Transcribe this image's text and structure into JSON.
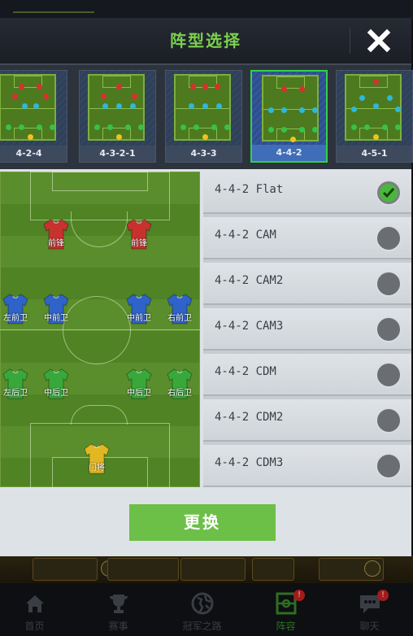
{
  "background": {
    "top_tabs": [
      "",
      "",
      "",
      ""
    ],
    "card_names": [
      "",
      "",
      "",
      "",
      ""
    ],
    "bottom_nav": [
      {
        "label": "首页",
        "icon": "home-icon"
      },
      {
        "label": "赛事",
        "icon": "trophy-icon"
      },
      {
        "label": "冠军之路",
        "icon": "globe-icon"
      },
      {
        "label": "阵容",
        "icon": "lineup-icon",
        "active": true,
        "badge": "!"
      },
      {
        "label": "聊天",
        "icon": "chat-icon",
        "badge": "!"
      }
    ]
  },
  "modal": {
    "title": "阵型选择",
    "close_icon": "close-icon"
  },
  "formations": [
    {
      "label": "4-2-4",
      "selected": false
    },
    {
      "label": "4-3-2-1",
      "selected": false
    },
    {
      "label": "4-3-3",
      "selected": false
    },
    {
      "label": "4-4-2",
      "selected": true
    },
    {
      "label": "4-5-1",
      "selected": false
    }
  ],
  "pitch": {
    "players": [
      {
        "name": "前锋",
        "role": "forward"
      },
      {
        "name": "前锋",
        "role": "forward"
      },
      {
        "name": "左前卫",
        "role": "midfielder"
      },
      {
        "name": "中前卫",
        "role": "midfielder"
      },
      {
        "name": "中前卫",
        "role": "midfielder"
      },
      {
        "name": "右前卫",
        "role": "midfielder"
      },
      {
        "name": "左后卫",
        "role": "defender"
      },
      {
        "name": "中后卫",
        "role": "defender"
      },
      {
        "name": "中后卫",
        "role": "defender"
      },
      {
        "name": "右后卫",
        "role": "defender"
      },
      {
        "name": "门将",
        "role": "goalkeeper"
      }
    ]
  },
  "variants": [
    {
      "label": "4-4-2 Flat",
      "checked": true
    },
    {
      "label": "4-4-2 CAM",
      "checked": false
    },
    {
      "label": "4-4-2 CAM2",
      "checked": false
    },
    {
      "label": "4-4-2 CAM3",
      "checked": false
    },
    {
      "label": "4-4-2 CDM",
      "checked": false
    },
    {
      "label": "4-4-2 CDM2",
      "checked": false
    },
    {
      "label": "4-4-2 CDM3",
      "checked": false
    }
  ],
  "confirm_label": "更换",
  "colors": {
    "title_green": "#7bd14e",
    "forward": "#c7322f",
    "midfielder": "#2f63c9",
    "defender": "#39a83b",
    "goalkeeper": "#e3b722",
    "check_green": "#49b83a",
    "confirm": "#6cbf47"
  }
}
